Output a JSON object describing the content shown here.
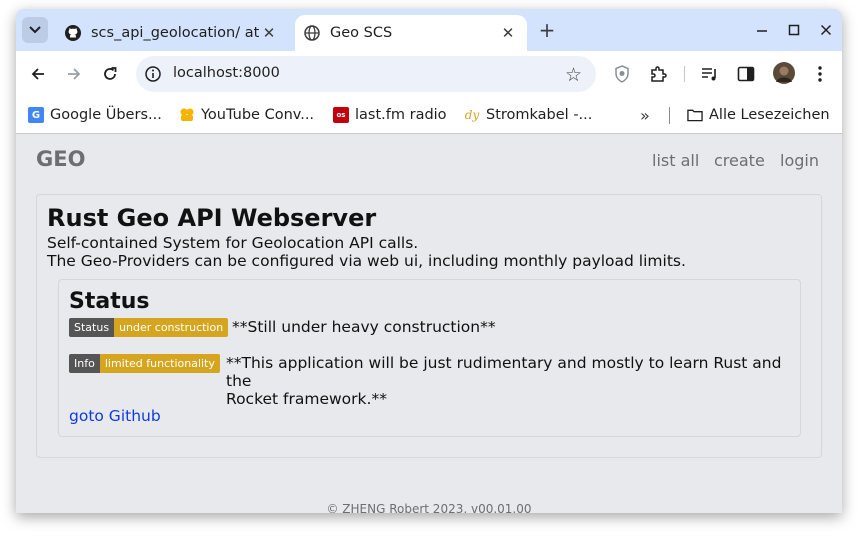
{
  "browser": {
    "tabs": [
      {
        "title": "scs_api_geolocation/ at",
        "favicon": "github-icon",
        "active": false
      },
      {
        "title": "Geo SCS",
        "favicon": "globe-icon",
        "active": true
      }
    ],
    "address": "localhost:8000",
    "bookmarks": [
      {
        "label": "Google Übers...",
        "favicon": "google-translate-icon",
        "color": "#4285f4"
      },
      {
        "label": "YouTube Conv...",
        "favicon": "youtube-converter-icon",
        "color": "#f4b400"
      },
      {
        "label": "last.fm radio",
        "favicon": "lastfm-icon",
        "color": "#c3000d"
      },
      {
        "label": "Stromkabel -...",
        "favicon": "dy-icon",
        "color": "#d6a520"
      }
    ],
    "all_bookmarks_label": "Alle Lesezeichen"
  },
  "site": {
    "brand": "GEO",
    "nav": [
      "list all",
      "create",
      "login"
    ]
  },
  "main": {
    "title": "Rust Geo API Webserver",
    "lead1": "Self-contained System for Geolocation API calls.",
    "lead2": "The Geo-Providers can be configured via web ui, including monthly payload limits.",
    "status": {
      "heading": "Status",
      "badge1": {
        "label": "Status",
        "message": "under construction"
      },
      "note1": "**Still under heavy construction**",
      "badge2": {
        "label": "Info",
        "message": "limited functionality"
      },
      "note2_line1": "**This application will be just rudimentary and mostly to learn Rust and the",
      "note2_line2": "Rocket framework.**",
      "link": "goto Github"
    }
  },
  "footer": "© ZHENG Robert 2023, v00.01.00",
  "colors": {
    "badge_gray": "#555555",
    "badge_yellow": "#d6a520",
    "link": "#0d3be0"
  }
}
